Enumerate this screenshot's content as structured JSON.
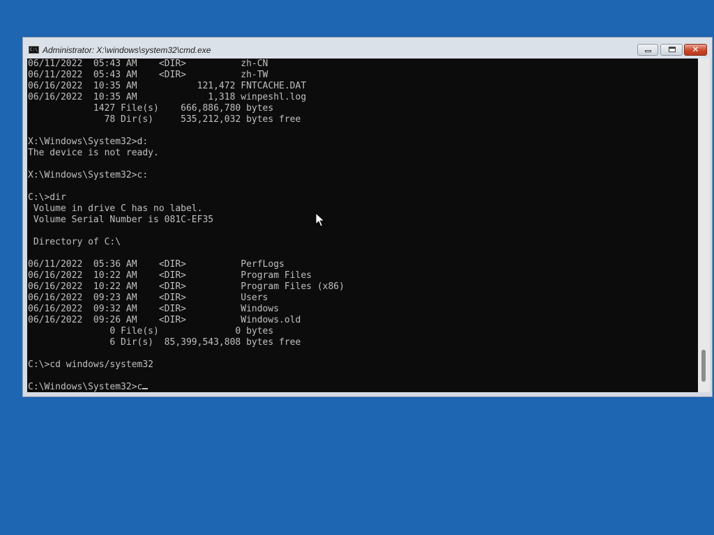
{
  "window": {
    "title": "Administrator: X:\\windows\\system32\\cmd.exe",
    "close_glyph": "✕"
  },
  "console": {
    "lines": [
      "06/11/2022  05:43 AM    <DIR>          zh-CN",
      "06/11/2022  05:43 AM    <DIR>          zh-TW",
      "06/16/2022  10:35 AM           121,472 FNTCACHE.DAT",
      "06/16/2022  10:35 AM             1,318 winpeshl.log",
      "            1427 File(s)    666,886,780 bytes",
      "              78 Dir(s)     535,212,032 bytes free",
      "",
      "X:\\Windows\\System32>d:",
      "The device is not ready.",
      "",
      "X:\\Windows\\System32>c:",
      "",
      "C:\\>dir",
      " Volume in drive C has no label.",
      " Volume Serial Number is 081C-EF35",
      "",
      " Directory of C:\\",
      "",
      "06/11/2022  05:36 AM    <DIR>          PerfLogs",
      "06/16/2022  10:22 AM    <DIR>          Program Files",
      "06/16/2022  10:22 AM    <DIR>          Program Files (x86)",
      "06/16/2022  09:23 AM    <DIR>          Users",
      "06/16/2022  09:32 AM    <DIR>          Windows",
      "06/16/2022  09:26 AM    <DIR>          Windows.old",
      "               0 File(s)              0 bytes",
      "               6 Dir(s)  85,399,543,808 bytes free",
      "",
      "C:\\>cd windows/system32",
      ""
    ],
    "prompt_line": "C:\\Windows\\System32>c"
  }
}
